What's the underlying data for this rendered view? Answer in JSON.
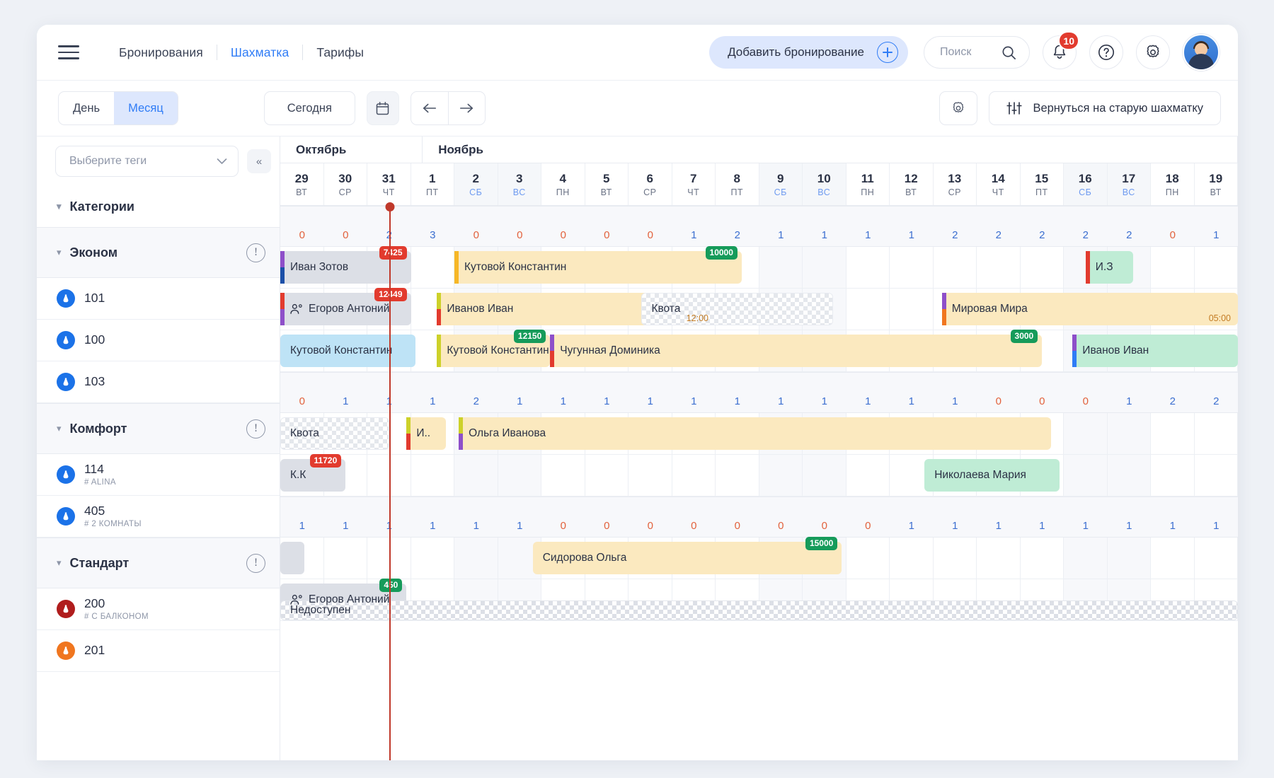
{
  "header": {
    "menu_icon": "hamburger-icon",
    "nav": [
      {
        "label": "Бронирования",
        "active": false
      },
      {
        "label": "Шахматка",
        "active": true
      },
      {
        "label": "Тарифы",
        "active": false
      }
    ],
    "add_booking_label": "Добавить бронирование",
    "search_placeholder": "Поиск",
    "notifications_count": "10",
    "help_label": "?",
    "settings_icon": "gear-icon",
    "avatar_icon": "user-avatar"
  },
  "toolbar": {
    "view_day": "День",
    "view_month": "Месяц",
    "active_view": "Месяц",
    "today_label": "Сегодня",
    "calendar_icon": "calendar-icon",
    "prev_icon": "arrow-left-icon",
    "next_icon": "arrow-right-icon",
    "settings_icon": "gear-icon",
    "old_grid_label": "Вернуться на старую шахматку",
    "old_grid_icon": "sliders-icon"
  },
  "sidebar": {
    "tags_placeholder": "Выберите теги",
    "collapse_icon": "double-chevron-left-icon",
    "categories_label": "Категории"
  },
  "calendar": {
    "months": [
      {
        "label": "Октябрь",
        "span": 3
      },
      {
        "label": "Ноябрь",
        "span": 19
      }
    ],
    "days": [
      {
        "num": "29",
        "wd": "ВТ",
        "weekend": false
      },
      {
        "num": "30",
        "wd": "СР",
        "weekend": false
      },
      {
        "num": "31",
        "wd": "ЧТ",
        "weekend": false,
        "today": true
      },
      {
        "num": "1",
        "wd": "ПТ",
        "weekend": false
      },
      {
        "num": "2",
        "wd": "СБ",
        "weekend": true
      },
      {
        "num": "3",
        "wd": "ВС",
        "weekend": true
      },
      {
        "num": "4",
        "wd": "ПН",
        "weekend": false
      },
      {
        "num": "5",
        "wd": "ВТ",
        "weekend": false
      },
      {
        "num": "6",
        "wd": "СР",
        "weekend": false
      },
      {
        "num": "7",
        "wd": "ЧТ",
        "weekend": false
      },
      {
        "num": "8",
        "wd": "ПТ",
        "weekend": false
      },
      {
        "num": "9",
        "wd": "СБ",
        "weekend": true
      },
      {
        "num": "10",
        "wd": "ВС",
        "weekend": true
      },
      {
        "num": "11",
        "wd": "ПН",
        "weekend": false
      },
      {
        "num": "12",
        "wd": "ВТ",
        "weekend": false
      },
      {
        "num": "13",
        "wd": "СР",
        "weekend": false
      },
      {
        "num": "14",
        "wd": "ЧТ",
        "weekend": false
      },
      {
        "num": "15",
        "wd": "ПТ",
        "weekend": false
      },
      {
        "num": "16",
        "wd": "СБ",
        "weekend": true
      },
      {
        "num": "17",
        "wd": "ВС",
        "weekend": true
      },
      {
        "num": "18",
        "wd": "ПН",
        "weekend": false
      },
      {
        "num": "19",
        "wd": "ВТ",
        "weekend": false
      }
    ]
  },
  "groups": [
    {
      "name": "Эконом",
      "warn_icon": "warning-icon",
      "availability": [
        "0",
        "0",
        "2",
        "3",
        "0",
        "0",
        "0",
        "0",
        "0",
        "1",
        "2",
        "1",
        "1",
        "1",
        "1",
        "2",
        "2",
        "2",
        "2",
        "2",
        "0",
        "1"
      ],
      "rooms": [
        {
          "number": "101",
          "subtitle": "",
          "icon_color": "#1b72e8"
        },
        {
          "number": "100",
          "subtitle": "",
          "icon_color": "#1b72e8"
        },
        {
          "number": "103",
          "subtitle": "",
          "icon_color": "#1b72e8"
        }
      ],
      "bookings": [
        [
          {
            "label": "Иван Зотов",
            "start": 0,
            "len": 3,
            "style": "gray",
            "price": "7425",
            "price_color": "red",
            "stripe_top": "#8e4fc9",
            "stripe_bottom": "#1b4fa8"
          },
          {
            "label": "Кутовой Константин",
            "start": 4,
            "len": 6.6,
            "style": "cream",
            "price": "10000",
            "price_color": "green",
            "stripe_top": "#f6b726",
            "stripe_bottom": "#f6b726"
          },
          {
            "label": "И.З",
            "start": 18.5,
            "len": 1.1,
            "style": "mint",
            "price": "",
            "price_color": "",
            "stripe_top": "#e23b2e",
            "stripe_bottom": "#e23b2e"
          }
        ],
        [
          {
            "label": "Егоров Антоний",
            "start": 0,
            "len": 3,
            "style": "gray",
            "price": "12449",
            "price_color": "red",
            "stripe_top": "#e23b2e",
            "stripe_bottom": "#8e4fc9",
            "group": true
          },
          {
            "label": "Иванов Иван",
            "start": 3.6,
            "len": 6.4,
            "style": "cream",
            "price": "",
            "price_color": "",
            "stripe_top": "#cdd12a",
            "stripe_bottom": "#e23b2e",
            "time": "12:00"
          },
          {
            "label": "Квота",
            "start": 8.3,
            "len": 4.4,
            "style": "quota",
            "price": "",
            "price_color": ""
          },
          {
            "label": "Мировая Мира",
            "start": 15.2,
            "len": 6.8,
            "style": "cream",
            "price": "",
            "price_color": "",
            "stripe_top": "#8e4fc9",
            "stripe_bottom": "#f0761f",
            "time": "05:00"
          }
        ],
        [
          {
            "label": "Кутовой Константин",
            "start": 0,
            "len": 3.1,
            "style": "sky",
            "price": "",
            "price_color": ""
          },
          {
            "label": "Кутовой Константин",
            "start": 3.6,
            "len": 2.6,
            "style": "cream",
            "price": "12150",
            "price_color": "green",
            "stripe_top": "#cdd12a",
            "stripe_bottom": "#cdd12a"
          },
          {
            "label": "Чугунная Доминика",
            "start": 6.2,
            "len": 11.3,
            "style": "cream",
            "price": "3000",
            "price_color": "green",
            "stripe_top": "#8e4fc9",
            "stripe_bottom": "#e23b2e"
          },
          {
            "label": "Иванов Иван",
            "start": 18.2,
            "len": 3.8,
            "style": "mint",
            "price": "",
            "price_color": "",
            "stripe_top": "#8e4fc9",
            "stripe_bottom": "#2f7cf6"
          }
        ]
      ]
    },
    {
      "name": "Комфорт",
      "warn_icon": "warning-icon",
      "availability": [
        "0",
        "1",
        "1",
        "1",
        "2",
        "1",
        "1",
        "1",
        "1",
        "1",
        "1",
        "1",
        "1",
        "1",
        "1",
        "1",
        "0",
        "0",
        "0",
        "1",
        "2",
        "2"
      ],
      "rooms": [
        {
          "number": "114",
          "subtitle": "# ALINA",
          "icon_color": "#1b72e8"
        },
        {
          "number": "405",
          "subtitle": "# 2 КОМНАТЫ",
          "icon_color": "#1b72e8"
        }
      ],
      "bookings": [
        [
          {
            "label": "Квота",
            "start": 0,
            "len": 2.5,
            "style": "quota",
            "price": "",
            "price_color": ""
          },
          {
            "label": "И..",
            "start": 2.9,
            "len": 0.9,
            "style": "cream",
            "price": "",
            "price_color": "",
            "stripe_top": "#cdd12a",
            "stripe_bottom": "#e23b2e"
          },
          {
            "label": "Ольга Иванова",
            "start": 4.1,
            "len": 13.6,
            "style": "cream",
            "price": "",
            "price_color": "",
            "stripe_top": "#cdd12a",
            "stripe_bottom": "#8e4fc9"
          }
        ],
        [
          {
            "label": "К.К",
            "start": 0,
            "len": 1.5,
            "style": "gray",
            "price": "11720",
            "price_color": "red"
          },
          {
            "label": "Николаева Мария",
            "start": 14.8,
            "len": 3.1,
            "style": "mint",
            "price": "",
            "price_color": ""
          }
        ]
      ]
    },
    {
      "name": "Стандарт",
      "warn_icon": "warning-icon",
      "availability": [
        "1",
        "1",
        "1",
        "1",
        "1",
        "1",
        "0",
        "0",
        "0",
        "0",
        "0",
        "0",
        "0",
        "0",
        "1",
        "1",
        "1",
        "1",
        "1",
        "1",
        "1",
        "1"
      ],
      "rooms": [
        {
          "number": "200",
          "subtitle": "# С БАЛКОНОМ",
          "icon_color": "#b01d1d"
        },
        {
          "number": "201",
          "subtitle": "",
          "icon_color": "#f0761f"
        }
      ],
      "bookings": [
        [
          {
            "label": "",
            "start": 0,
            "len": 0.55,
            "style": "gray",
            "price": "",
            "price_color": ""
          },
          {
            "label": "Сидорова Ольга",
            "start": 5.8,
            "len": 7.1,
            "style": "cream",
            "price": "15000",
            "price_color": "green"
          }
        ],
        [
          {
            "label": "Егоров Антоний",
            "start": 0,
            "len": 2.9,
            "style": "gray",
            "price": "450",
            "price_color": "green",
            "group": true
          },
          {
            "label": "Недоступен",
            "start": 0,
            "len": 22,
            "style": "unavail",
            "price": "",
            "price_color": "",
            "second_row": true
          }
        ]
      ]
    }
  ]
}
